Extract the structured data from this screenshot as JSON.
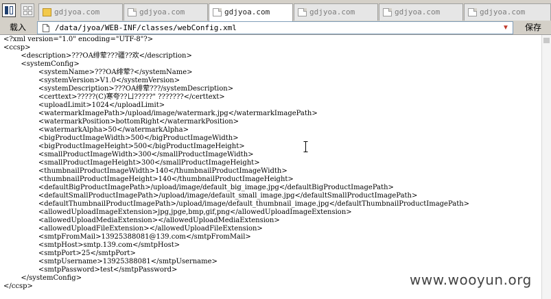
{
  "tabs": [
    {
      "label": "gdjyoa.com",
      "icon": "folder-icon"
    },
    {
      "label": "gdjyoa.com",
      "icon": "doc-icon"
    },
    {
      "label": "gdjyoa.com",
      "icon": "doc-icon",
      "active": true
    },
    {
      "label": "gdjyoa.com",
      "icon": "doc-icon"
    },
    {
      "label": "gdjyoa.com",
      "icon": "doc-icon"
    },
    {
      "label": "gdjyoa.com",
      "icon": "doc-icon"
    }
  ],
  "toolbar": {
    "load_label": "载入",
    "address": "/data/jyoa/WEB-INF/classes/webConfig.xml",
    "save_label": "保存"
  },
  "file_lines": [
    "<?xml version=\"1.0\" encoding=\"UTF-8\"?>",
    "<ccsp>",
    "        <description>???OA绯荤???疆??欢</description>",
    "        <systemConfig>",
    "                <systemName>???OA绯荤?</systemName>",
    "                <systemVersion>V1.0</systemVersion>",
    "                <systemDescription>???OA绯荤???/systemDescription>",
    "                <certtext>?????(C)寒夸??ㄩ?????\" ???????</certtext>",
    "                <uploadLimit>1024</uploadLimit>",
    "                <watermarkImagePath>/upload/image/watermark.jpg</watermarkImagePath>",
    "                <watermarkPosition>bottomRight</watermarkPosition>",
    "                <watermarkAlpha>50</watermarkAlpha>",
    "                <bigProductImageWidth>500</bigProductImageWidth>",
    "                <bigProductImageHeight>500</bigProductImageHeight>",
    "                <smallProductImageWidth>300</smallProductImageWidth>",
    "                <smallProductImageHeight>300</smallProductImageHeight>",
    "                <thumbnailProductImageWidth>140</thumbnailProductImageWidth>",
    "                <thumbnailProductImageHeight>140</thumbnailProductImageHeight>",
    "                <defaultBigProductImagePath>/upload/image/default_big_image.jpg</defaultBigProductImagePath>",
    "                <defaultSmallProductImagePath>/upload/image/default_small_image.jpg</defaultSmallProductImagePath>",
    "                <defaultThumbnailProductImagePath>/upload/image/default_thumbnail_image.jpg</defaultThumbnailProductImagePath>",
    "                <allowedUploadImageExtension>jpg,jpge,bmp,gif,png</allowedUploadImageExtension>",
    "                <allowedUploadMediaExtension></allowedUploadMediaExtension>",
    "                <allowedUploadFileExtension></allowedUploadFileExtension>",
    "                <smtpFromMail>13925388081@139.com</smtpFromMail>",
    "                <smtpHost>smtp.139.com</smtpHost>",
    "                <smtpPort>25</smtpPort>",
    "                <smtpUsername>13925388081</smtpUsername>",
    "                <smtpPassword>test</smtpPassword>",
    "        </systemConfig>",
    "</ccsp>"
  ],
  "watermark": "www.wooyun.org",
  "colors": {
    "chrome": "#d4d0c8",
    "address_border": "#7f9db9",
    "dropdown": "#c0392b"
  }
}
